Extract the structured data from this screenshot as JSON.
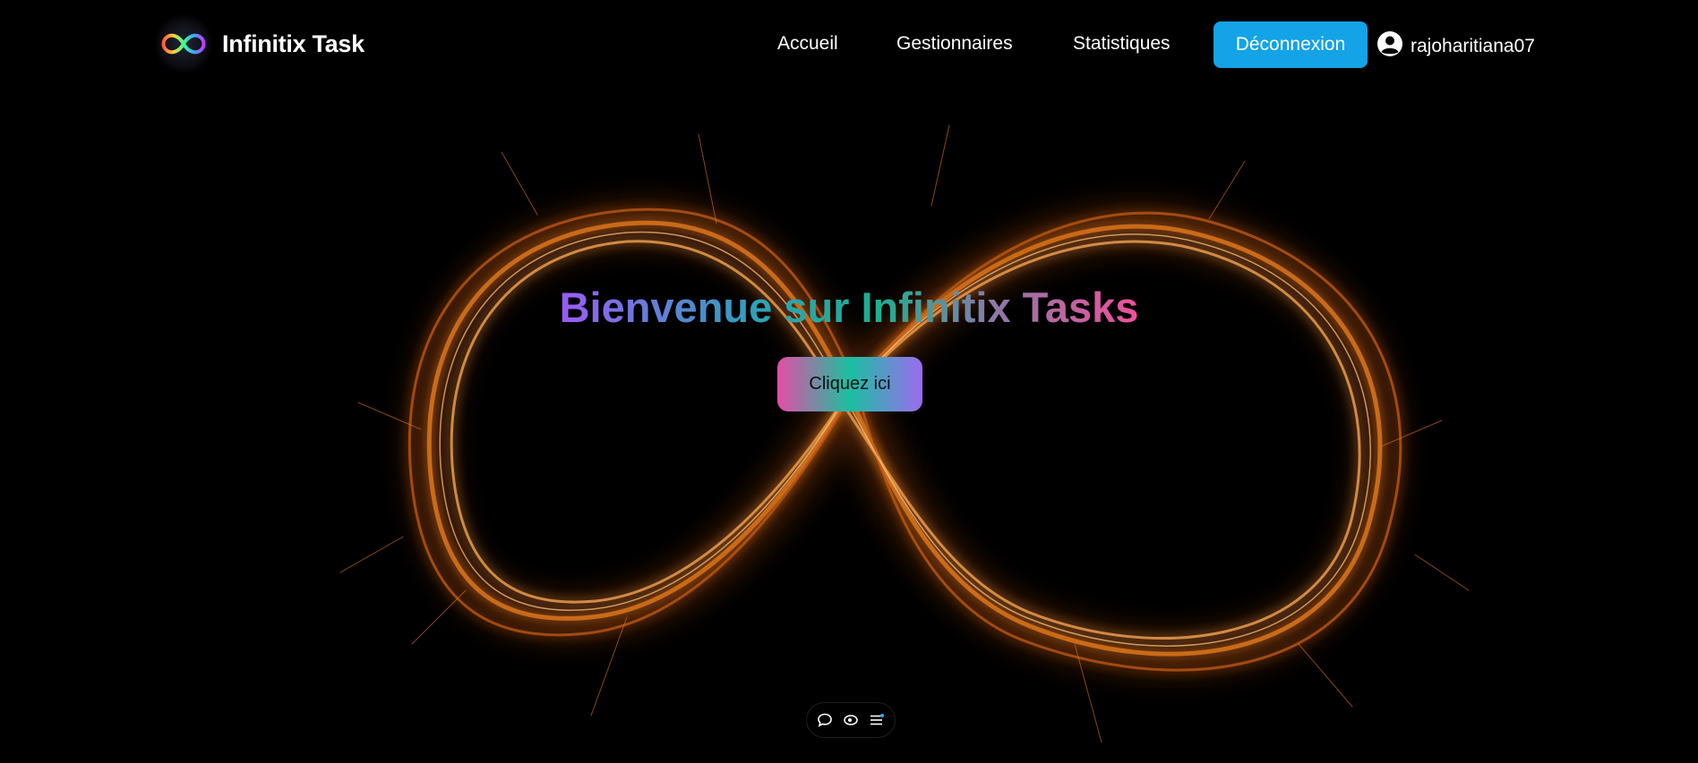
{
  "brand": {
    "name": "Infinitix Task",
    "logo_icon": "infinity-logo-icon"
  },
  "nav": {
    "items": [
      {
        "label": "Accueil"
      },
      {
        "label": "Gestionnaires"
      },
      {
        "label": "Statistiques"
      }
    ],
    "logout_label": "Déconnexion",
    "user": {
      "icon": "user-circle-icon",
      "name": "rajoharitiana07"
    }
  },
  "hero": {
    "title": "Bienvenue sur Infinitix Tasks",
    "cta_label": "Cliquez ici",
    "background": "glowing-infinity-sparkler-image"
  },
  "toolbar": {
    "icons": [
      "comment-icon",
      "eye-icon",
      "menu-lines-icon"
    ]
  },
  "colors": {
    "accent": "#13a3e6",
    "background": "#000000",
    "glow": "#e07a1f"
  }
}
